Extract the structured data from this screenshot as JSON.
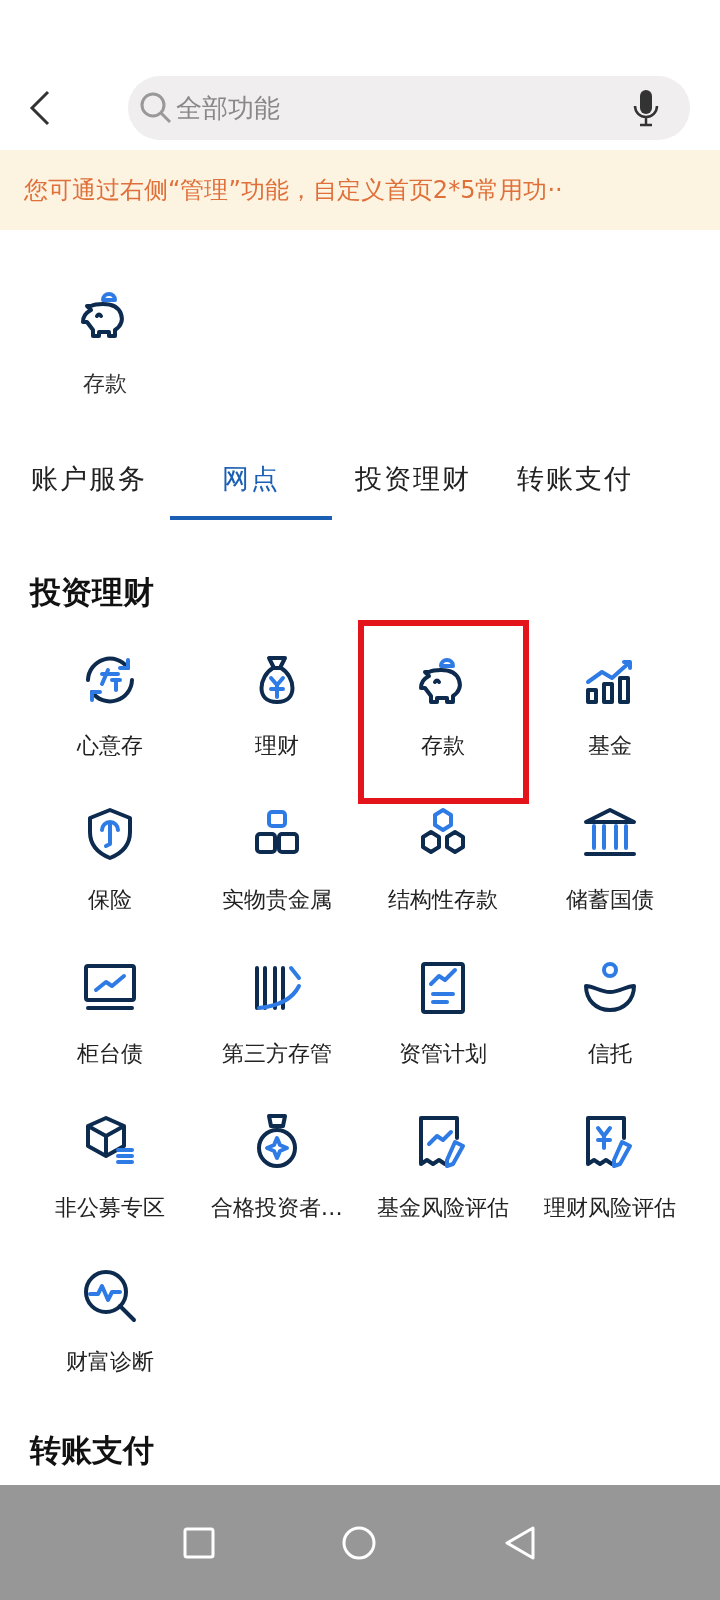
{
  "search": {
    "placeholder": "全部功能"
  },
  "notice": "您可通过右侧“管理”功能，自定义首页2*5常用功··",
  "favorites": [
    {
      "label": "存款"
    }
  ],
  "tabs": [
    {
      "label": "账户服务",
      "selected": false
    },
    {
      "label": "网点",
      "selected": true
    },
    {
      "label": "投资理财",
      "selected": false
    },
    {
      "label": "转账支付",
      "selected": false
    }
  ],
  "sections": [
    {
      "title": "投资理财",
      "items": [
        {
          "label": "心意存",
          "highlighted": false
        },
        {
          "label": "理财",
          "highlighted": false
        },
        {
          "label": "存款",
          "highlighted": true
        },
        {
          "label": "基金",
          "highlighted": false
        },
        {
          "label": "保险",
          "highlighted": false
        },
        {
          "label": "实物贵金属",
          "highlighted": false
        },
        {
          "label": "结构性存款",
          "highlighted": false
        },
        {
          "label": "储蓄国债",
          "highlighted": false
        },
        {
          "label": "柜台债",
          "highlighted": false
        },
        {
          "label": "第三方存管",
          "highlighted": false
        },
        {
          "label": "资管计划",
          "highlighted": false
        },
        {
          "label": "信托",
          "highlighted": false
        },
        {
          "label": "非公募专区",
          "highlighted": false
        },
        {
          "label": "合格投资者…",
          "highlighted": false
        },
        {
          "label": "基金风险评估",
          "highlighted": false
        },
        {
          "label": "理财风险评估",
          "highlighted": false
        },
        {
          "label": "财富诊断",
          "highlighted": false
        }
      ]
    },
    {
      "title": "转账支付"
    }
  ]
}
